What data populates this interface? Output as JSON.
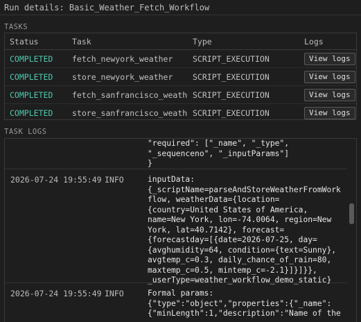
{
  "header": {
    "title": "Run details: Basic_Weather_Fetch_Workflow"
  },
  "tasks": {
    "section_label": "TASKS",
    "columns": [
      "Status",
      "Task",
      "Type",
      "Logs"
    ],
    "rows": [
      {
        "status": "COMPLETED",
        "task": "fetch_newyork_weather",
        "type": "SCRIPT_EXECUTION",
        "logs_label": "View logs"
      },
      {
        "status": "COMPLETED",
        "task": "store_newyork_weather",
        "type": "SCRIPT_EXECUTION",
        "logs_label": "View logs"
      },
      {
        "status": "COMPLETED",
        "task": "fetch_sanfrancisco_weather",
        "type": "SCRIPT_EXECUTION",
        "logs_label": "View logs"
      },
      {
        "status": "COMPLETED",
        "task": "store_sanfrancisco_weather",
        "type": "SCRIPT_EXECUTION",
        "logs_label": "View logs"
      }
    ]
  },
  "logs": {
    "section_label": "TASK LOGS",
    "entries": [
      {
        "time": "",
        "level": "",
        "message": "\"required\": [\"_name\", \"_type\",\n\"_sequenceno\", \"_inputParams\"]\n}"
      },
      {
        "time": "2026-07-24 19:55:49",
        "level": "INFO",
        "message": "inputData:\n{_scriptName=parseAndStoreWeatherFromWork\nflow, weatherData={location=\n{country=United States of America,\nname=New York, lon=-74.0064, region=New\nYork, lat=40.7142}, forecast=\n{forecastday=[{date=2026-07-25, day=\n{avghumidity=64, condition={text=Sunny},\navgtemp_c=0.3, daily_chance_of_rain=80,\nmaxtemp_c=0.5, mintemp_c=-2.1}]}]}},\n_userType=weather_workflow_demo_static}"
      },
      {
        "time": "2026-07-24 19:55:49",
        "level": "INFO",
        "message": "Formal params:\n{\"type\":\"object\",\"properties\":{\"_name\":\n{\"minLength\":1,\"description\":\"Name of the"
      }
    ]
  },
  "colors": {
    "status_completed": "#4ec9b0",
    "background": "#1e1e1e"
  }
}
